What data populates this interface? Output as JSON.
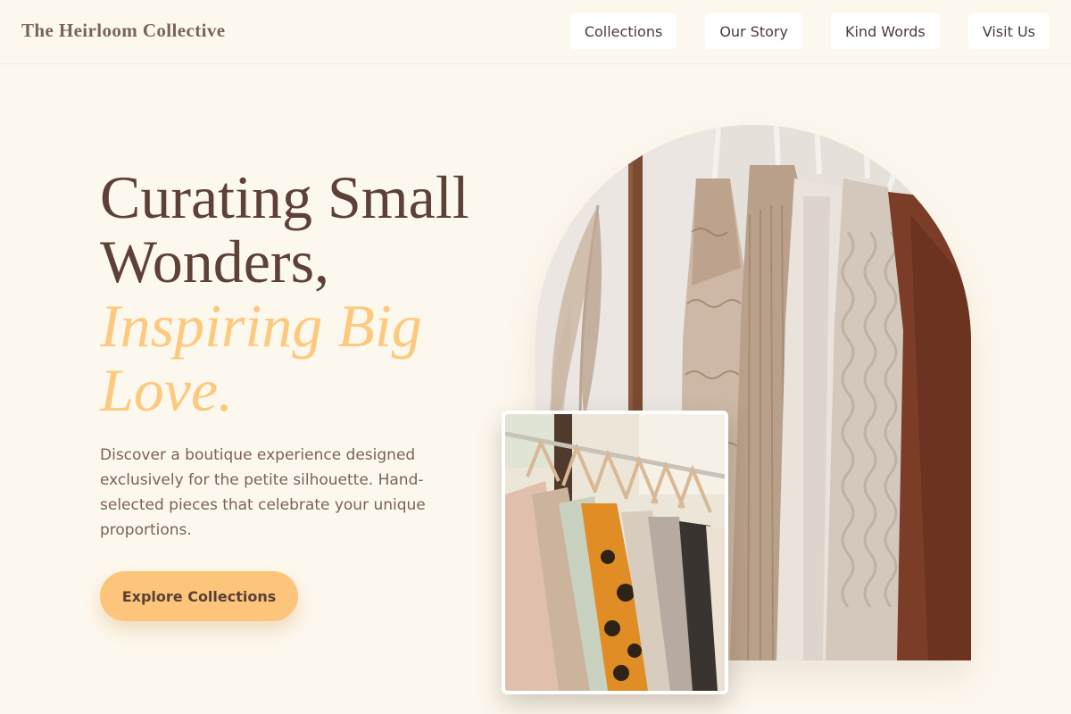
{
  "header": {
    "brand": "The Heirloom Collective",
    "nav": [
      {
        "label": "Collections"
      },
      {
        "label": "Our Story"
      },
      {
        "label": "Kind Words"
      },
      {
        "label": "Visit Us"
      }
    ]
  },
  "hero": {
    "title_line1": "Curating Small",
    "title_line2": "Wonders,",
    "title_accent_line1": "Inspiring Big",
    "title_accent_line2": "Love.",
    "subtitle": "Discover a boutique experience designed exclusively for the petite silhouette. Hand-selected pieces that celebrate your unique proportions.",
    "cta_label": "Explore Collections"
  },
  "colors": {
    "background": "#fdf8ee",
    "heading": "#5d4037",
    "accent": "#fcc97e",
    "body_text": "#7b6158",
    "button": "#fdc57c"
  },
  "images": {
    "arch": "clothing-rack-sweaters-photo",
    "inset": "clothing-rack-hangers-photo"
  }
}
